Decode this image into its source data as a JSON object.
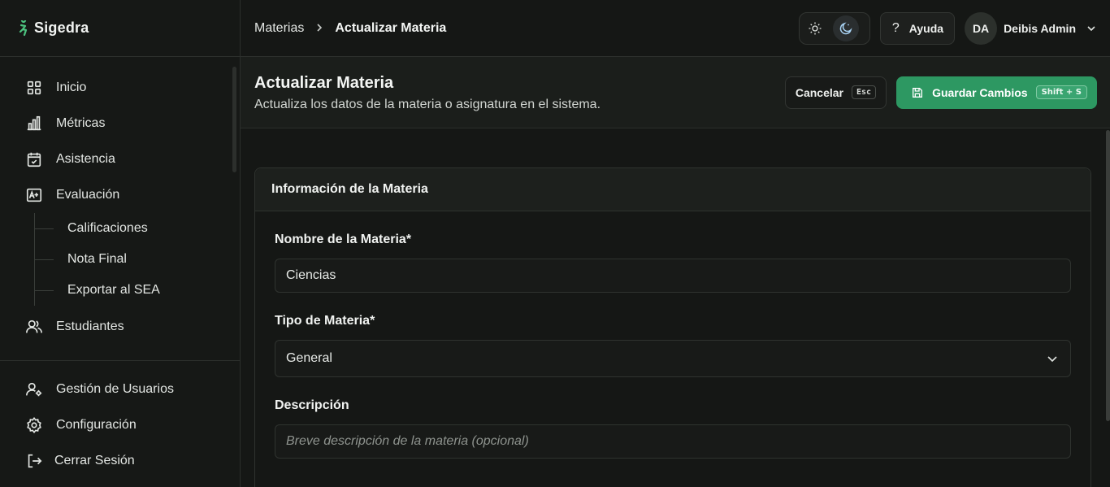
{
  "brand": {
    "name": "Sigedra"
  },
  "sidebar": {
    "items": [
      {
        "label": "Inicio",
        "icon": "grid-icon"
      },
      {
        "label": "Métricas",
        "icon": "bar-chart-icon"
      },
      {
        "label": "Asistencia",
        "icon": "calendar-check-icon"
      },
      {
        "label": "Evaluación",
        "icon": "grade-icon"
      }
    ],
    "subitems": [
      "Calificaciones",
      "Nota Final",
      "Exportar al SEA"
    ],
    "after": [
      {
        "label": "Estudiantes",
        "icon": "users-icon"
      }
    ],
    "bottom": [
      {
        "label": "Gestión de Usuarios",
        "icon": "user-cog-icon"
      },
      {
        "label": "Configuración",
        "icon": "settings-icon"
      },
      {
        "label": "Cerrar Sesión",
        "icon": "logout-icon"
      }
    ]
  },
  "topbar": {
    "breadcrumb_parent": "Materias",
    "breadcrumb_current": "Actualizar Materia",
    "help_label": "Ayuda",
    "user_initials": "DA",
    "user_name": "Deibis Admin"
  },
  "page": {
    "title": "Actualizar Materia",
    "subtitle": "Actualiza los datos de la materia o asignatura en el sistema.",
    "cancel_label": "Cancelar",
    "cancel_key": "Esc",
    "save_label": "Guardar Cambios",
    "save_key": "Shift + S"
  },
  "form": {
    "card_title": "Información de la Materia",
    "name_label": "Nombre de la Materia*",
    "name_value": "Ciencias",
    "type_label": "Tipo de Materia*",
    "type_value": "General",
    "description_label": "Descripción",
    "description_placeholder": "Breve descripción de la materia (opcional)"
  },
  "colors": {
    "accent": "#2d9862",
    "brand_icon": "#4cc27f"
  }
}
